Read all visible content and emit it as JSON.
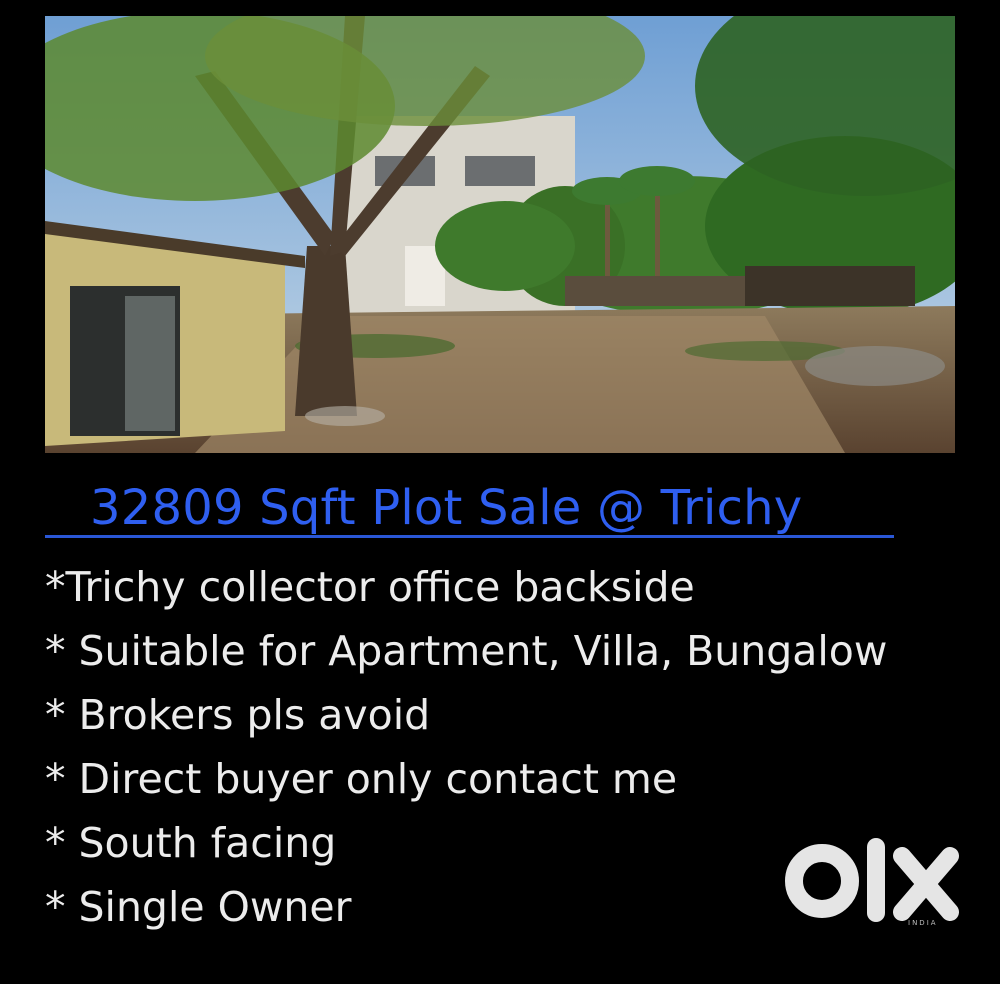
{
  "listing": {
    "title": "32809 Sqft Plot Sale @ Trichy",
    "photo": {
      "subject": "open plot with trees and buildings"
    },
    "bullets": [
      "*Trichy collector office backside",
      "* Suitable for Apartment, Villa, Bungalow",
      "* Brokers pls avoid",
      "* Direct buyer only contact me",
      "* South facing",
      "* Single Owner"
    ]
  },
  "brand": {
    "logo_text": "OLX",
    "logo_subtext": "INDIA",
    "logo_color": "#e5e5e5"
  },
  "colors": {
    "background": "#000000",
    "title": "#2f5ff0",
    "underline": "#2a57d6",
    "body_text": "#ececec"
  }
}
